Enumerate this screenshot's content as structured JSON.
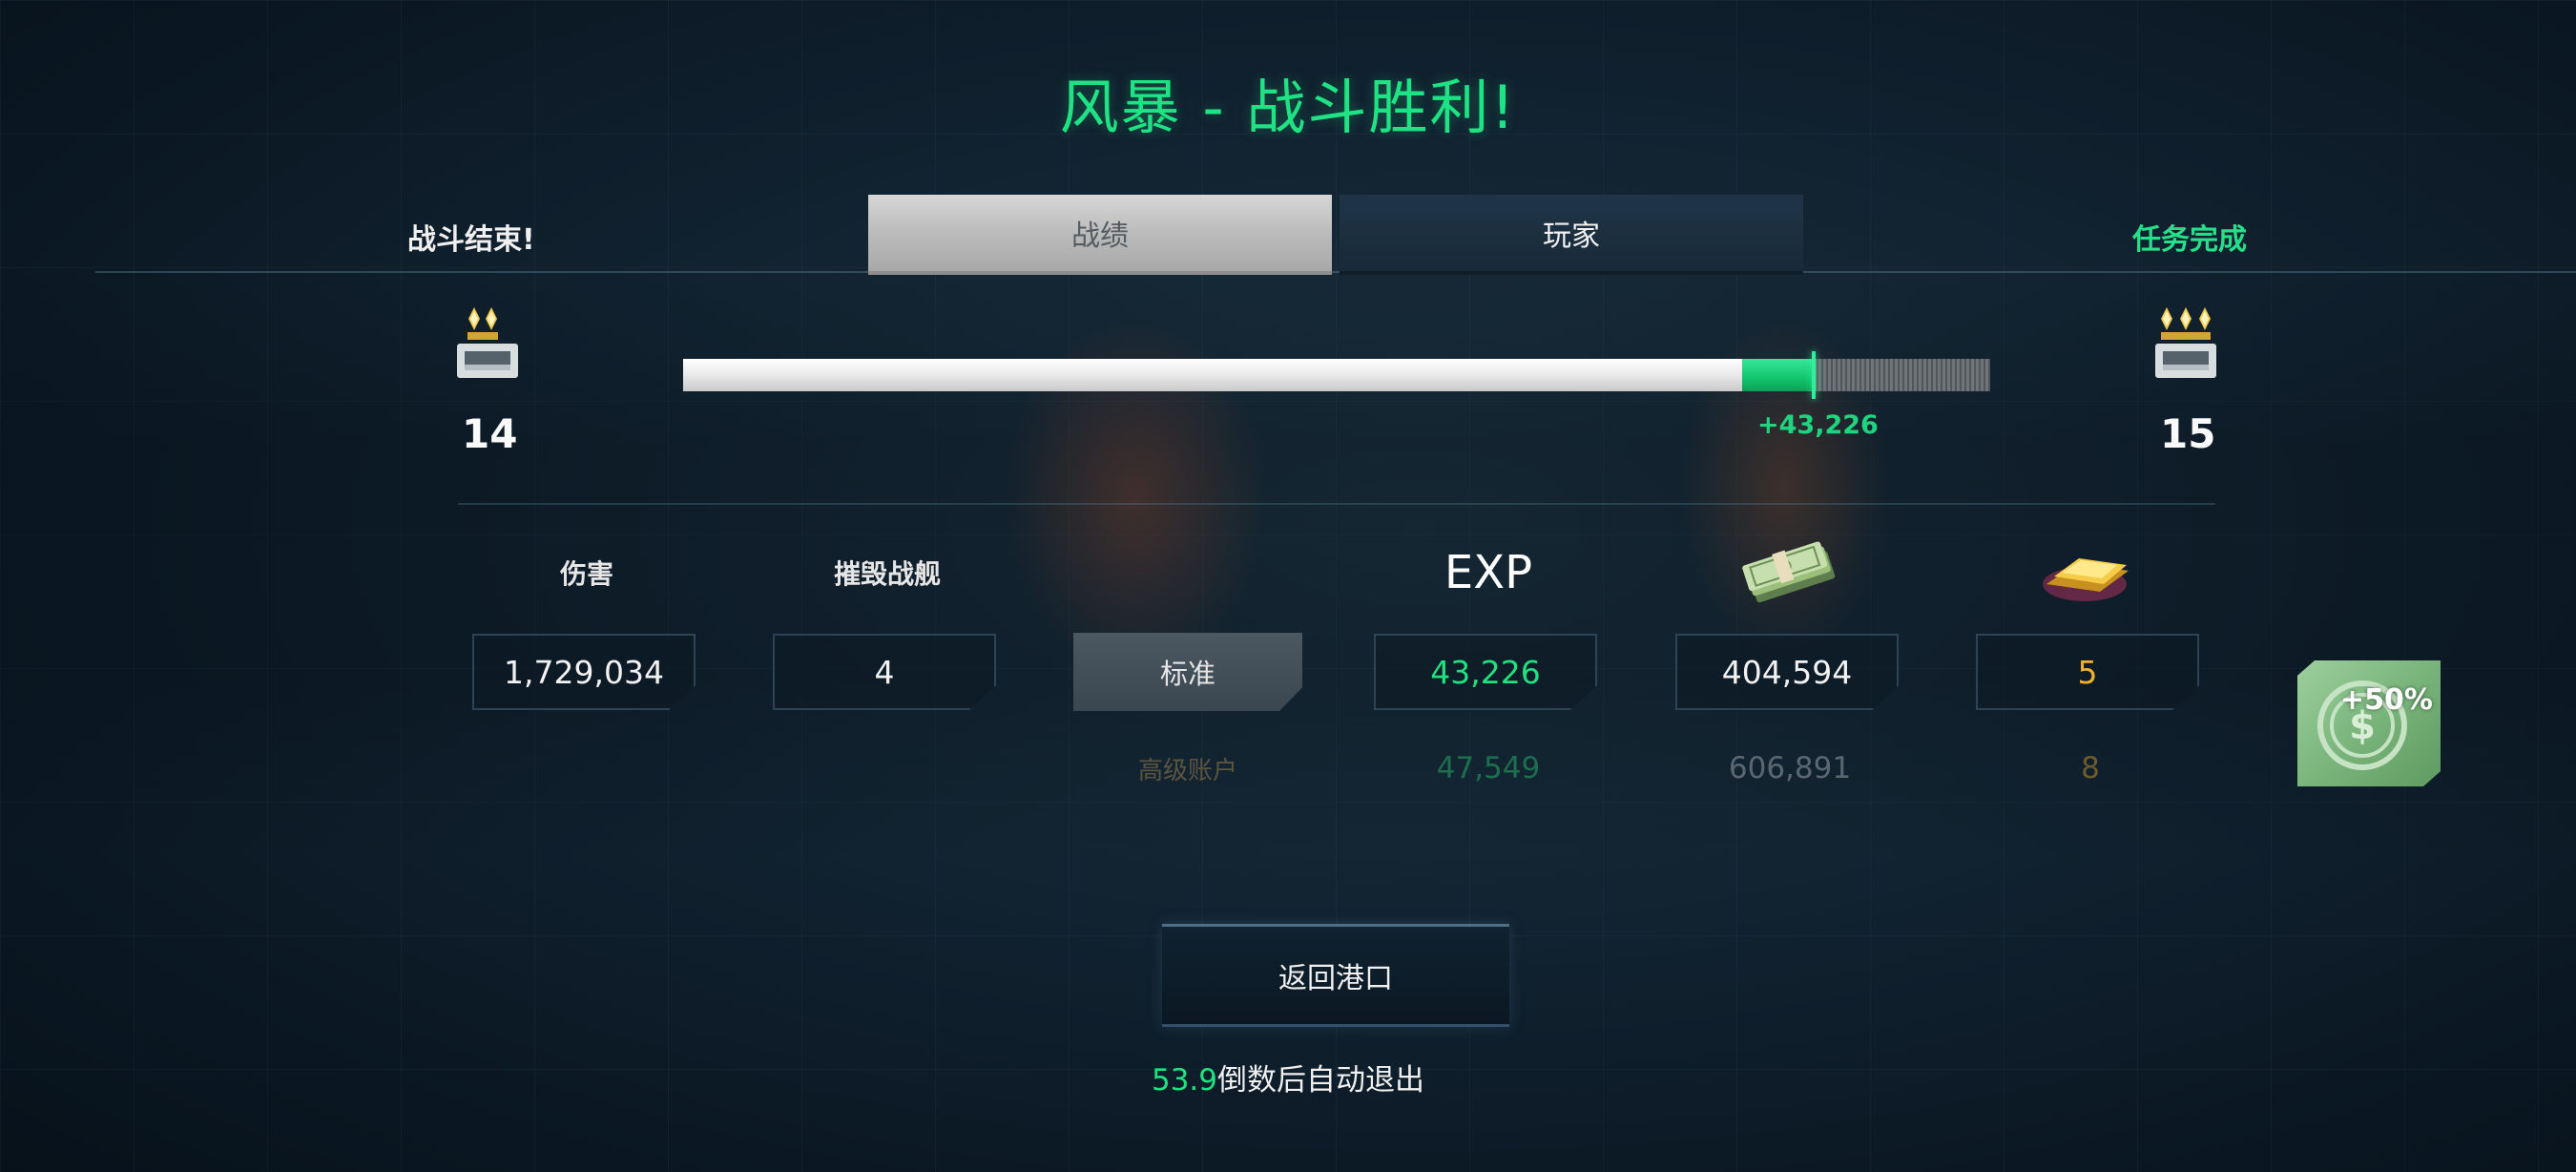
{
  "title": "风暴 - 战斗胜利!",
  "status": {
    "battle_over": "战斗结束!",
    "mission_complete": "任务完成"
  },
  "tabs": [
    {
      "label": "战绩",
      "active": true
    },
    {
      "label": "玩家",
      "active": false
    }
  ],
  "rank": {
    "current": "14",
    "next": "15",
    "current_icon": "rank-insignia-2-pips-icon",
    "next_icon": "rank-insignia-3-pips-icon"
  },
  "xp_progress": {
    "base_fraction": 0.81,
    "gain_fraction": 0.055,
    "gain_label": "+43,226"
  },
  "stats": {
    "headers": {
      "damage": "伤害",
      "destroyed": "摧毁战舰",
      "exp": "EXP",
      "money_icon": "cash-stack-icon",
      "gold_icon": "gold-bar-icon"
    },
    "damage": "1,729,034",
    "destroyed": "4",
    "standard_label": "标准",
    "standard_exp": "43,226",
    "standard_money": "404,594",
    "standard_gold": "5",
    "premium_label": "高级账户",
    "premium_exp": "47,549",
    "premium_money": "606,891",
    "premium_gold": "8"
  },
  "bonus_badge": {
    "text": "+50%",
    "icon": "dollar-coin-icon"
  },
  "return_button": "返回港口",
  "countdown": {
    "seconds": "53.9",
    "text": "倒数后自动退出"
  },
  "colors": {
    "accent_green": "#1fe285",
    "gold": "#f1b12a",
    "background": "#0f2130"
  }
}
